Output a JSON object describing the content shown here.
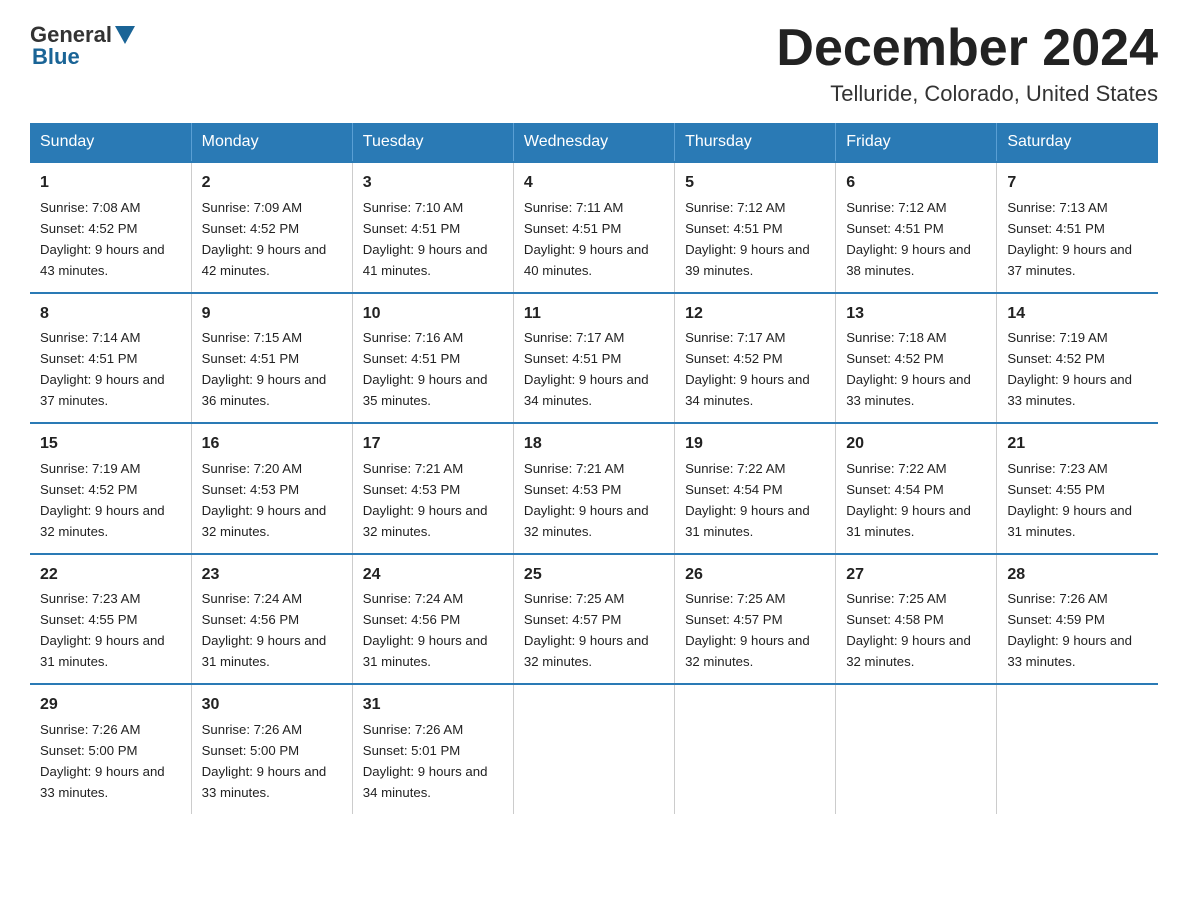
{
  "logo": {
    "general": "General",
    "blue": "Blue"
  },
  "title": "December 2024",
  "location": "Telluride, Colorado, United States",
  "days_of_week": [
    "Sunday",
    "Monday",
    "Tuesday",
    "Wednesday",
    "Thursday",
    "Friday",
    "Saturday"
  ],
  "weeks": [
    [
      {
        "num": "1",
        "sunrise": "7:08 AM",
        "sunset": "4:52 PM",
        "daylight": "9 hours and 43 minutes."
      },
      {
        "num": "2",
        "sunrise": "7:09 AM",
        "sunset": "4:52 PM",
        "daylight": "9 hours and 42 minutes."
      },
      {
        "num": "3",
        "sunrise": "7:10 AM",
        "sunset": "4:51 PM",
        "daylight": "9 hours and 41 minutes."
      },
      {
        "num": "4",
        "sunrise": "7:11 AM",
        "sunset": "4:51 PM",
        "daylight": "9 hours and 40 minutes."
      },
      {
        "num": "5",
        "sunrise": "7:12 AM",
        "sunset": "4:51 PM",
        "daylight": "9 hours and 39 minutes."
      },
      {
        "num": "6",
        "sunrise": "7:12 AM",
        "sunset": "4:51 PM",
        "daylight": "9 hours and 38 minutes."
      },
      {
        "num": "7",
        "sunrise": "7:13 AM",
        "sunset": "4:51 PM",
        "daylight": "9 hours and 37 minutes."
      }
    ],
    [
      {
        "num": "8",
        "sunrise": "7:14 AM",
        "sunset": "4:51 PM",
        "daylight": "9 hours and 37 minutes."
      },
      {
        "num": "9",
        "sunrise": "7:15 AM",
        "sunset": "4:51 PM",
        "daylight": "9 hours and 36 minutes."
      },
      {
        "num": "10",
        "sunrise": "7:16 AM",
        "sunset": "4:51 PM",
        "daylight": "9 hours and 35 minutes."
      },
      {
        "num": "11",
        "sunrise": "7:17 AM",
        "sunset": "4:51 PM",
        "daylight": "9 hours and 34 minutes."
      },
      {
        "num": "12",
        "sunrise": "7:17 AM",
        "sunset": "4:52 PM",
        "daylight": "9 hours and 34 minutes."
      },
      {
        "num": "13",
        "sunrise": "7:18 AM",
        "sunset": "4:52 PM",
        "daylight": "9 hours and 33 minutes."
      },
      {
        "num": "14",
        "sunrise": "7:19 AM",
        "sunset": "4:52 PM",
        "daylight": "9 hours and 33 minutes."
      }
    ],
    [
      {
        "num": "15",
        "sunrise": "7:19 AM",
        "sunset": "4:52 PM",
        "daylight": "9 hours and 32 minutes."
      },
      {
        "num": "16",
        "sunrise": "7:20 AM",
        "sunset": "4:53 PM",
        "daylight": "9 hours and 32 minutes."
      },
      {
        "num": "17",
        "sunrise": "7:21 AM",
        "sunset": "4:53 PM",
        "daylight": "9 hours and 32 minutes."
      },
      {
        "num": "18",
        "sunrise": "7:21 AM",
        "sunset": "4:53 PM",
        "daylight": "9 hours and 32 minutes."
      },
      {
        "num": "19",
        "sunrise": "7:22 AM",
        "sunset": "4:54 PM",
        "daylight": "9 hours and 31 minutes."
      },
      {
        "num": "20",
        "sunrise": "7:22 AM",
        "sunset": "4:54 PM",
        "daylight": "9 hours and 31 minutes."
      },
      {
        "num": "21",
        "sunrise": "7:23 AM",
        "sunset": "4:55 PM",
        "daylight": "9 hours and 31 minutes."
      }
    ],
    [
      {
        "num": "22",
        "sunrise": "7:23 AM",
        "sunset": "4:55 PM",
        "daylight": "9 hours and 31 minutes."
      },
      {
        "num": "23",
        "sunrise": "7:24 AM",
        "sunset": "4:56 PM",
        "daylight": "9 hours and 31 minutes."
      },
      {
        "num": "24",
        "sunrise": "7:24 AM",
        "sunset": "4:56 PM",
        "daylight": "9 hours and 31 minutes."
      },
      {
        "num": "25",
        "sunrise": "7:25 AM",
        "sunset": "4:57 PM",
        "daylight": "9 hours and 32 minutes."
      },
      {
        "num": "26",
        "sunrise": "7:25 AM",
        "sunset": "4:57 PM",
        "daylight": "9 hours and 32 minutes."
      },
      {
        "num": "27",
        "sunrise": "7:25 AM",
        "sunset": "4:58 PM",
        "daylight": "9 hours and 32 minutes."
      },
      {
        "num": "28",
        "sunrise": "7:26 AM",
        "sunset": "4:59 PM",
        "daylight": "9 hours and 33 minutes."
      }
    ],
    [
      {
        "num": "29",
        "sunrise": "7:26 AM",
        "sunset": "5:00 PM",
        "daylight": "9 hours and 33 minutes."
      },
      {
        "num": "30",
        "sunrise": "7:26 AM",
        "sunset": "5:00 PM",
        "daylight": "9 hours and 33 minutes."
      },
      {
        "num": "31",
        "sunrise": "7:26 AM",
        "sunset": "5:01 PM",
        "daylight": "9 hours and 34 minutes."
      },
      {
        "num": "",
        "sunrise": "",
        "sunset": "",
        "daylight": ""
      },
      {
        "num": "",
        "sunrise": "",
        "sunset": "",
        "daylight": ""
      },
      {
        "num": "",
        "sunrise": "",
        "sunset": "",
        "daylight": ""
      },
      {
        "num": "",
        "sunrise": "",
        "sunset": "",
        "daylight": ""
      }
    ]
  ],
  "labels": {
    "sunrise_prefix": "Sunrise: ",
    "sunset_prefix": "Sunset: ",
    "daylight_prefix": "Daylight: "
  }
}
